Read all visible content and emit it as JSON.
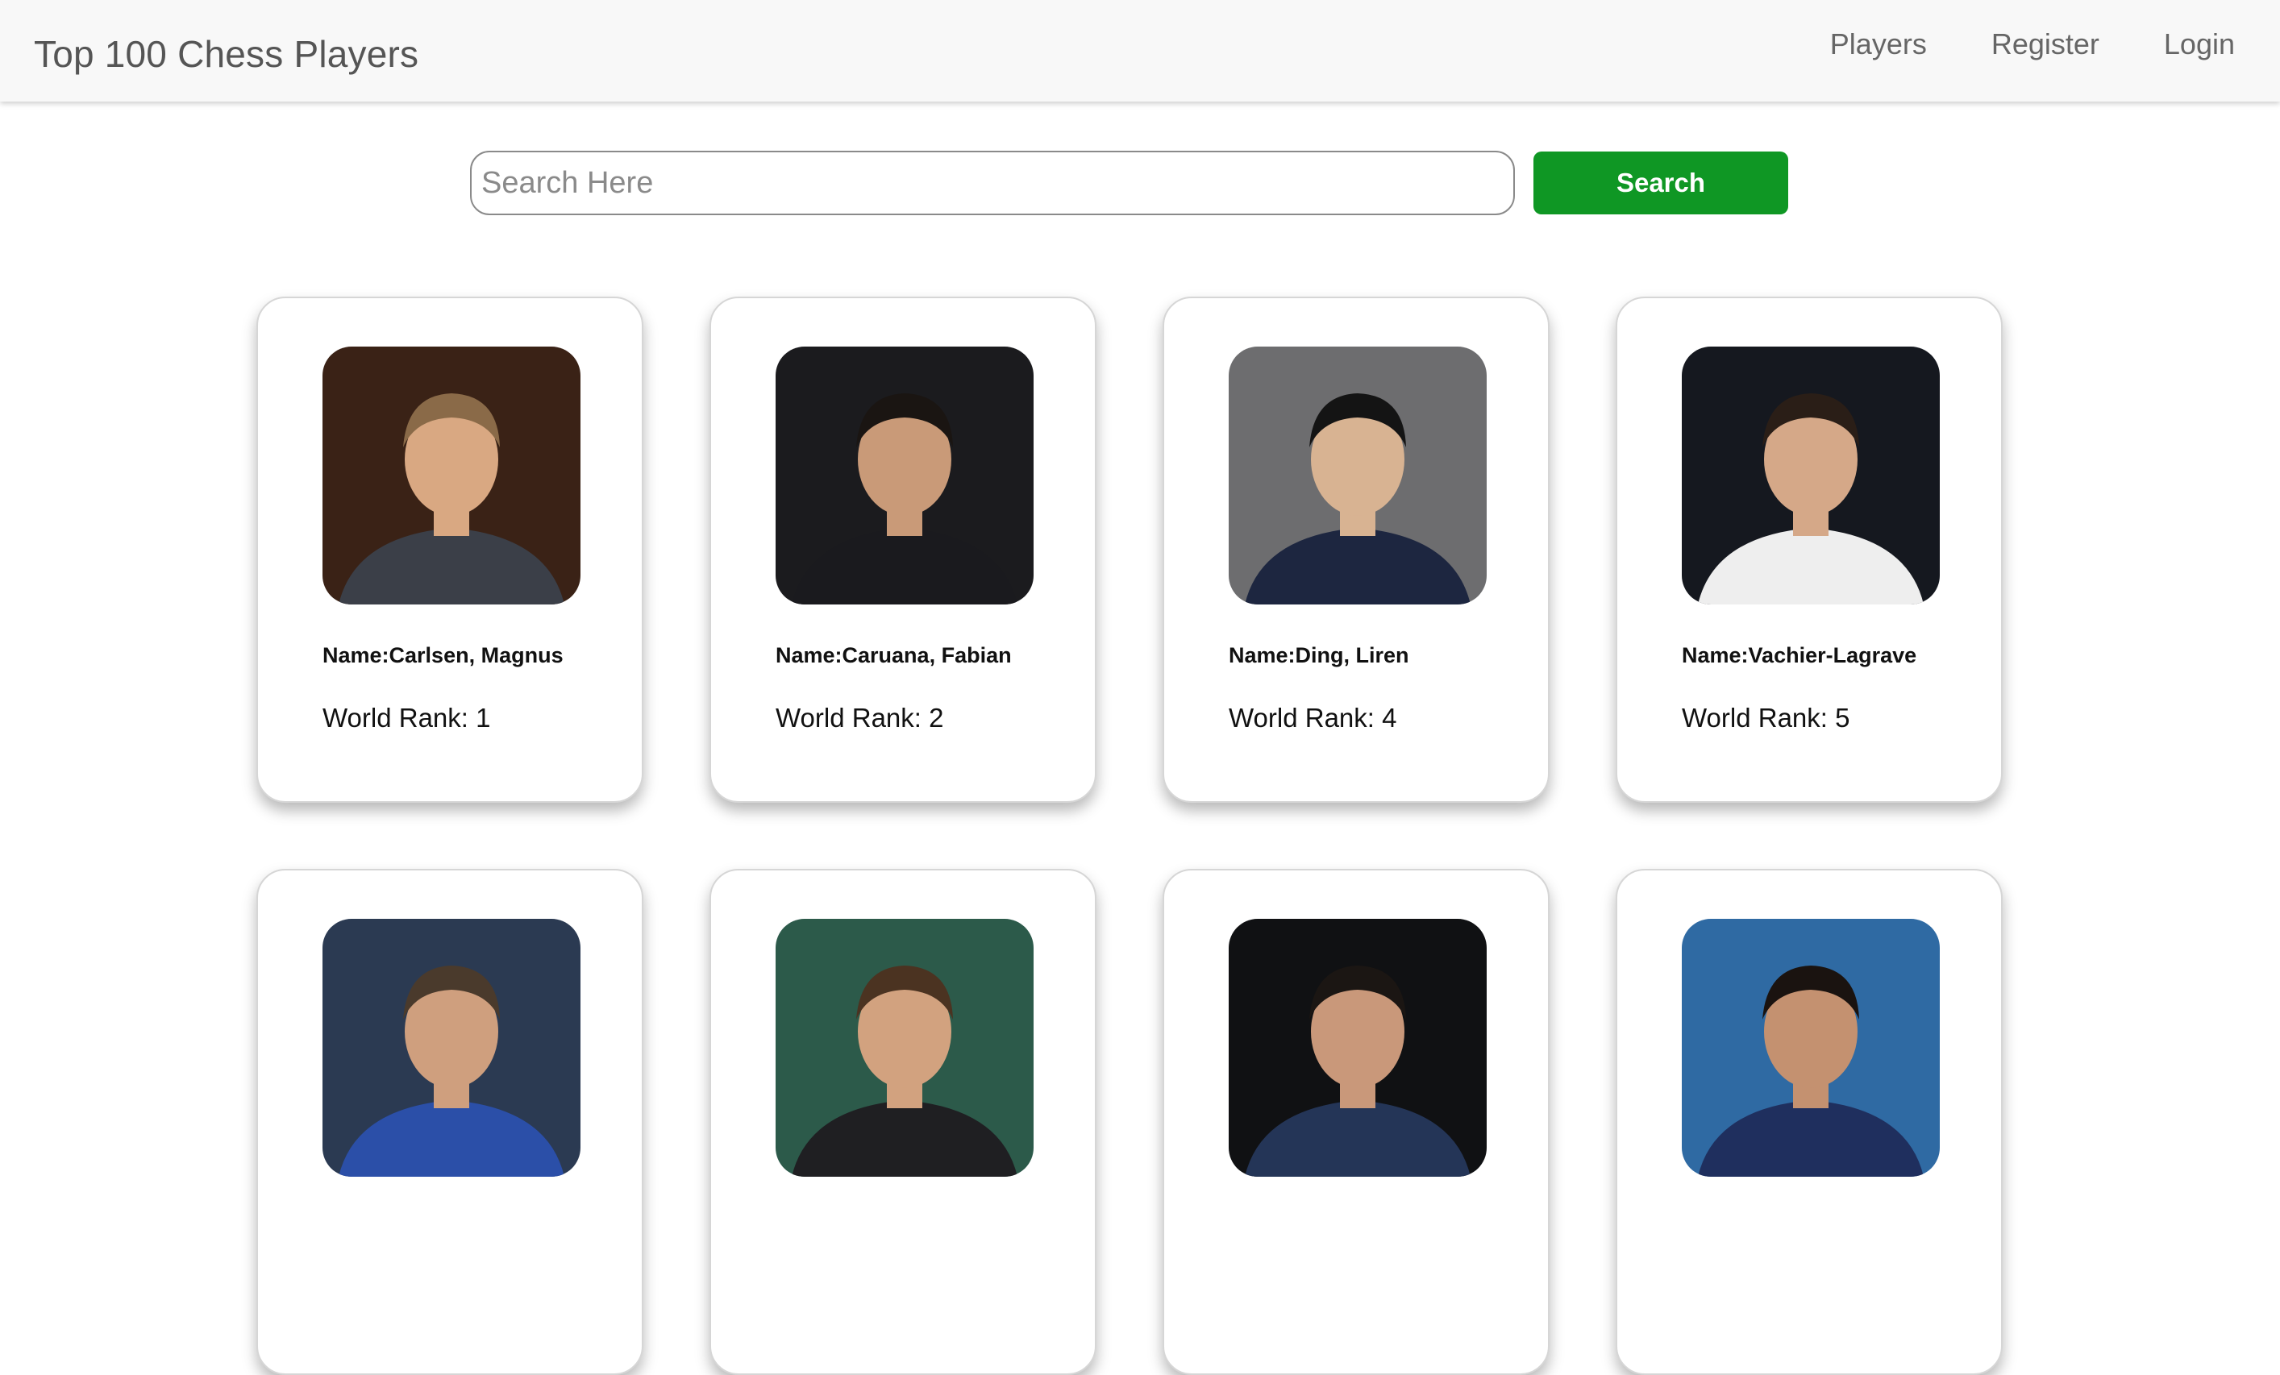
{
  "navbar": {
    "brand": "Top 100 Chess Players",
    "links": [
      {
        "label": "Players"
      },
      {
        "label": "Register"
      },
      {
        "label": "Login"
      }
    ]
  },
  "search": {
    "placeholder": "Search Here",
    "value": "",
    "button_label": "Search"
  },
  "colors": {
    "search_button": "#0f9724",
    "navbar_bg": "#f8f8f8"
  },
  "players": [
    {
      "name": "Name:Carlsen, Magnus",
      "rank": "World Rank: 1",
      "photo": "player-photo-carlsen",
      "bg": "#3a2216",
      "suit": "#3b3f48",
      "skin": "#d9a882",
      "hair": "#8a6a48"
    },
    {
      "name": "Name:Caruana, Fabian",
      "rank": "World Rank: 2",
      "photo": "player-photo-caruana",
      "bg": "#1b1b1e",
      "suit": "#1a1a1e",
      "skin": "#c99a78",
      "hair": "#1a1512"
    },
    {
      "name": "Name:Ding, Liren",
      "rank": "World Rank: 4",
      "photo": "player-photo-ding",
      "bg": "#6d6d6f",
      "suit": "#1d2640",
      "skin": "#d8b392",
      "hair": "#141414"
    },
    {
      "name": "Name:Vachier-Lagrave",
      "rank": "World Rank: 5",
      "photo": "player-photo-vachier-lagrave",
      "bg": "#15181f",
      "suit": "#eeeeee",
      "skin": "#d5a888",
      "hair": "#2a1e17"
    },
    {
      "name": "",
      "rank": "",
      "photo": "player-photo-grischuk",
      "bg": "#2b3a52",
      "suit": "#2b4fa8",
      "skin": "#cf9f7e",
      "hair": "#4a3a2c"
    },
    {
      "name": "",
      "rank": "",
      "photo": "player-photo-aronian",
      "bg": "#2c5a4a",
      "suit": "#1f1f22",
      "skin": "#d2a27f",
      "hair": "#4b3321"
    },
    {
      "name": "",
      "rank": "",
      "photo": "player-photo-mamedyarov",
      "bg": "#101113",
      "suit": "#243557",
      "skin": "#c9987a",
      "hair": "#1b1613"
    },
    {
      "name": "",
      "rank": "",
      "photo": "player-photo-giri",
      "bg": "#2f6aa3",
      "suit": "#1f2f5e",
      "skin": "#c49170",
      "hair": "#1a1310"
    }
  ]
}
